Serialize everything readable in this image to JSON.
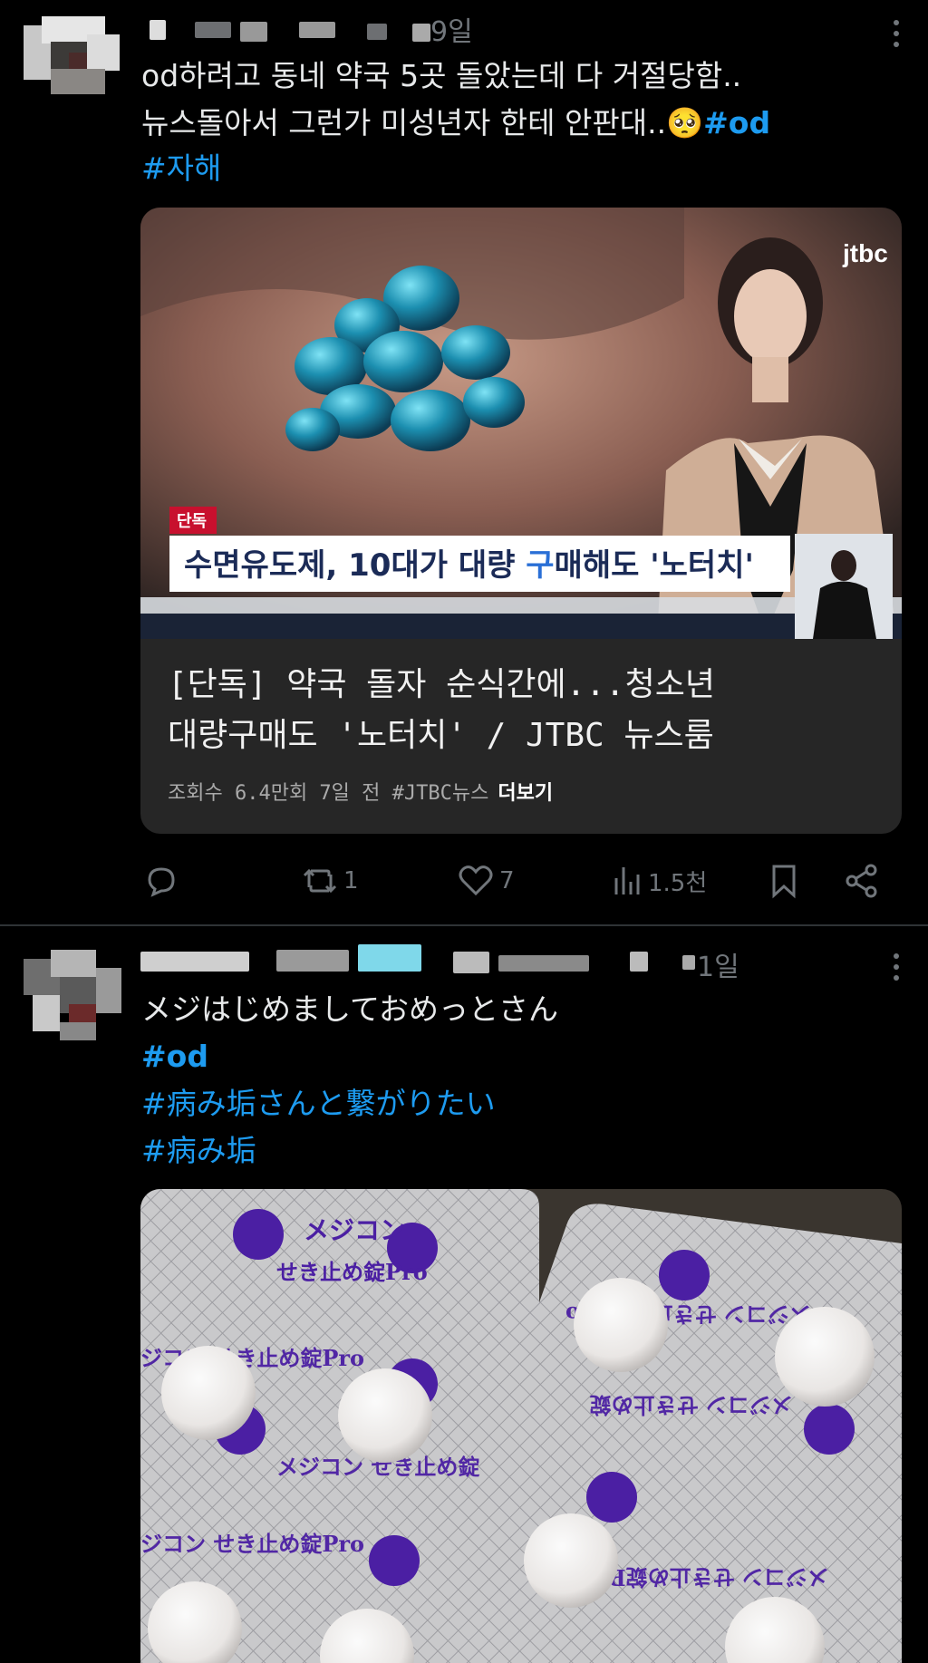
{
  "posts": [
    {
      "time": "9일",
      "text_line1": "od하려고 동네 약국 5곳 돌았는데 다 거절당함..",
      "text_line2_prefix": "뉴스돌아서 그런가 미성년자 한테 안판대..",
      "emoji": "🥺",
      "hashtag_inline": "#od",
      "hashtag_line3": "#자해",
      "video": {
        "channel_logo": "jtbc",
        "badge": "단독",
        "caption_a": "수면유도제, 10대가 대량 ",
        "caption_b": "구",
        "caption_c": "매해도 '노터치'"
      },
      "card": {
        "title_line1": "[단독] 약국 돌자 순식간에...청소년",
        "title_line2": "대량구매도 '노터치' / JTBC 뉴스룸",
        "meta": "조회수 6.4만회  7일 전  #JTBC뉴스",
        "more": "더보기"
      },
      "actions": {
        "reply": "",
        "repost": "1",
        "like": "7",
        "views": "1.5천"
      }
    },
    {
      "time": "1일",
      "text_line1": "メジはじめましておめっとさん",
      "hashtags": [
        "#od",
        "#病み垢さんと繋がりたい",
        "#病み垢"
      ],
      "blister": {
        "brand": "メジコン",
        "sub": "せき止め錠Pro"
      }
    }
  ],
  "colors": {
    "background": "#000000",
    "text": "#e7e9ea",
    "secondary": "#71767b",
    "link": "#1d9bf0",
    "card": "#262626"
  }
}
